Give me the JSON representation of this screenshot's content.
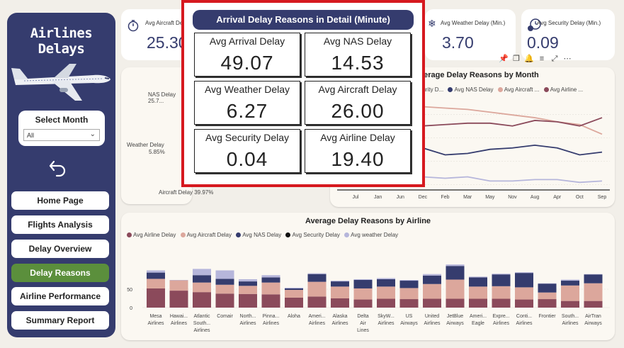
{
  "sidebar": {
    "title": "Airlines Delays",
    "month_filter": {
      "label": "Select Month",
      "value": "All"
    },
    "nav": [
      {
        "label": "Home Page",
        "active": false
      },
      {
        "label": "Flights Analysis",
        "active": false
      },
      {
        "label": "Delay Overview",
        "active": false
      },
      {
        "label": "Delay Reasons",
        "active": true
      },
      {
        "label": "Airline Performance",
        "active": false
      },
      {
        "label": "Summary Report",
        "active": false
      }
    ]
  },
  "kpis": [
    {
      "label": "Avg Aircraft Delay",
      "value": "25.30"
    },
    {
      "label": "Avg Weather Delay (Min.)",
      "value": "3.70"
    },
    {
      "label": "Avg Security Delay (Min.)",
      "value": "0.09"
    }
  ],
  "detail_popup": {
    "title": "Arrival Delay Reasons in Detail (Minute)",
    "cells": [
      {
        "label": "Avg Arrival Delay",
        "value": "49.07"
      },
      {
        "label": "Avg NAS Delay",
        "value": "14.53"
      },
      {
        "label": "Avg Weather Delay",
        "value": "6.27"
      },
      {
        "label": "Avg Aircraft Delay",
        "value": "26.00"
      },
      {
        "label": "Avg Security Delay",
        "value": "0.04"
      },
      {
        "label": "Avg Airline Delay",
        "value": "19.40"
      }
    ]
  },
  "pie": {
    "labels": [
      "NAS Delay 25.7...",
      "Weather Delay",
      "5.85%",
      "Aircraft Delay 39.97%"
    ]
  },
  "colors": {
    "airline": "#8b4a5b",
    "aircraft": "#dca79c",
    "nas": "#353c6e",
    "security": "#111111",
    "weather": "#b6b6db"
  },
  "chart_data": [
    {
      "type": "line",
      "title": "verage Delay Reasons by Month",
      "legend": [
        "ecurity D...",
        "Avg NAS Delay",
        "Avg Aircraft ...",
        "Avg Airline ..."
      ],
      "x": [
        "Jul",
        "Jan",
        "Jun",
        "Dec",
        "Feb",
        "Mar",
        "May",
        "Nov",
        "Aug",
        "Apr",
        "Oct",
        "Sep"
      ],
      "series": [
        {
          "key": "aircraft",
          "values": [
            33,
            33,
            33,
            32,
            31,
            30,
            28,
            26,
            24,
            21,
            19,
            12
          ]
        },
        {
          "key": "airline",
          "values": [
            15,
            16,
            17,
            18,
            19,
            20,
            20,
            18,
            22,
            21,
            18,
            24
          ]
        },
        {
          "key": "nas",
          "values": [
            8,
            9,
            11,
            2,
            -3,
            -2,
            1,
            2,
            4,
            2,
            -3,
            -1
          ]
        },
        {
          "key": "weather",
          "values": [
            -10,
            -10,
            -12,
            -19,
            -20,
            -19,
            -22,
            -22,
            -21,
            -21,
            -23,
            -22
          ]
        }
      ],
      "ylim": [
        -28,
        40
      ]
    },
    {
      "type": "bar",
      "title": "Average Delay Reasons by Airline",
      "legend": [
        "Avg Airline Delay",
        "Avg Aircraft Delay",
        "Avg NAS Delay",
        "Avg Security Delay",
        "Avg weather Delay"
      ],
      "yticks": [
        "0",
        "50"
      ],
      "ylim": [
        0,
        160
      ],
      "categories": [
        [
          "Mesa",
          "Airlines"
        ],
        [
          "Hawai...",
          "Airlines"
        ],
        [
          "Atlantic",
          "South...",
          "Airlines"
        ],
        [
          "Comair"
        ],
        [
          "North...",
          "Airlines"
        ],
        [
          "Pinna...",
          "Airlines"
        ],
        [
          "Aloha"
        ],
        [
          "Ameri...",
          "Airlines"
        ],
        [
          "Alaska",
          "Airlines"
        ],
        [
          "Delta",
          "Air",
          "Lines"
        ],
        [
          "SkyW...",
          "Airlines"
        ],
        [
          "US",
          "Airways"
        ],
        [
          "United",
          "Airlines"
        ],
        [
          "JetBlue",
          "Airways"
        ],
        [
          "Ameri...",
          "Eagle"
        ],
        [
          "Expre...",
          "Airlines"
        ],
        [
          "Conti...",
          "Airlines"
        ],
        [
          "Frontier"
        ],
        [
          "South...",
          "Airlines"
        ],
        [
          "AirTran",
          "Airways"
        ]
      ],
      "series": [
        {
          "key": "airline",
          "values": [
            52,
            46,
            42,
            38,
            37,
            36,
            27,
            30,
            25,
            22,
            24,
            23,
            24,
            24,
            24,
            24,
            22,
            23,
            18,
            18
          ]
        },
        {
          "key": "aircraft",
          "values": [
            26,
            28,
            26,
            24,
            22,
            32,
            21,
            40,
            32,
            30,
            33,
            30,
            40,
            52,
            33,
            34,
            33,
            18,
            42,
            48
          ]
        },
        {
          "key": "nas",
          "values": [
            17,
            0,
            20,
            16,
            12,
            14,
            4,
            21,
            14,
            23,
            20,
            20,
            23,
            37,
            25,
            32,
            39,
            24,
            13,
            24
          ]
        },
        {
          "key": "security",
          "values": [
            0,
            0,
            0,
            0,
            0,
            0,
            0,
            0,
            0,
            0,
            0,
            0,
            0,
            0,
            0,
            0,
            0,
            0,
            0,
            0
          ]
        },
        {
          "key": "weather",
          "values": [
            6,
            1,
            17,
            23,
            6,
            6,
            2,
            2,
            2,
            2,
            3,
            2,
            4,
            4,
            2,
            2,
            2,
            1,
            3,
            1
          ]
        }
      ]
    }
  ]
}
